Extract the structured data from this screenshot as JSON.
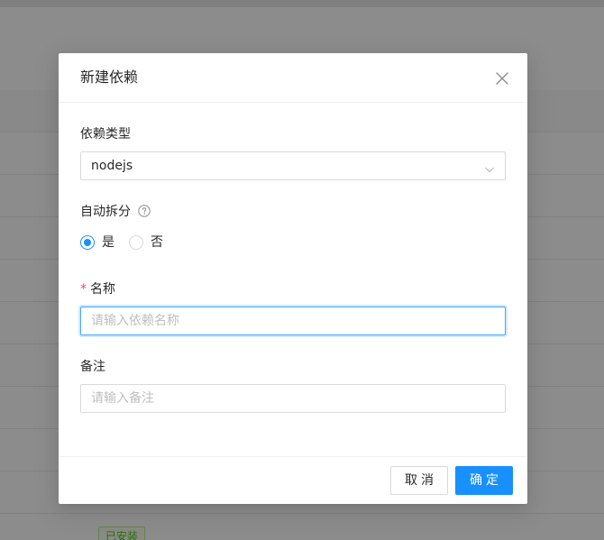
{
  "background": {
    "badge_label": "已安装"
  },
  "modal": {
    "title": "新建依赖",
    "close_icon": "close-icon",
    "fields": {
      "type": {
        "label": "依赖类型",
        "value": "nodejs"
      },
      "auto_split": {
        "label": "自动拆分",
        "help_icon": "question-circle-icon",
        "options": [
          "是",
          "否"
        ],
        "selected": "是"
      },
      "name": {
        "required_mark": "*",
        "label": "名称",
        "placeholder": "请输入依赖名称",
        "value": ""
      },
      "remark": {
        "label": "备注",
        "placeholder": "请输入备注",
        "value": ""
      }
    },
    "footer": {
      "cancel_label": "取消",
      "ok_label": "确定"
    }
  },
  "colors": {
    "primary": "#1890ff",
    "required": "#ff4d4f",
    "success": "#52c41a"
  }
}
